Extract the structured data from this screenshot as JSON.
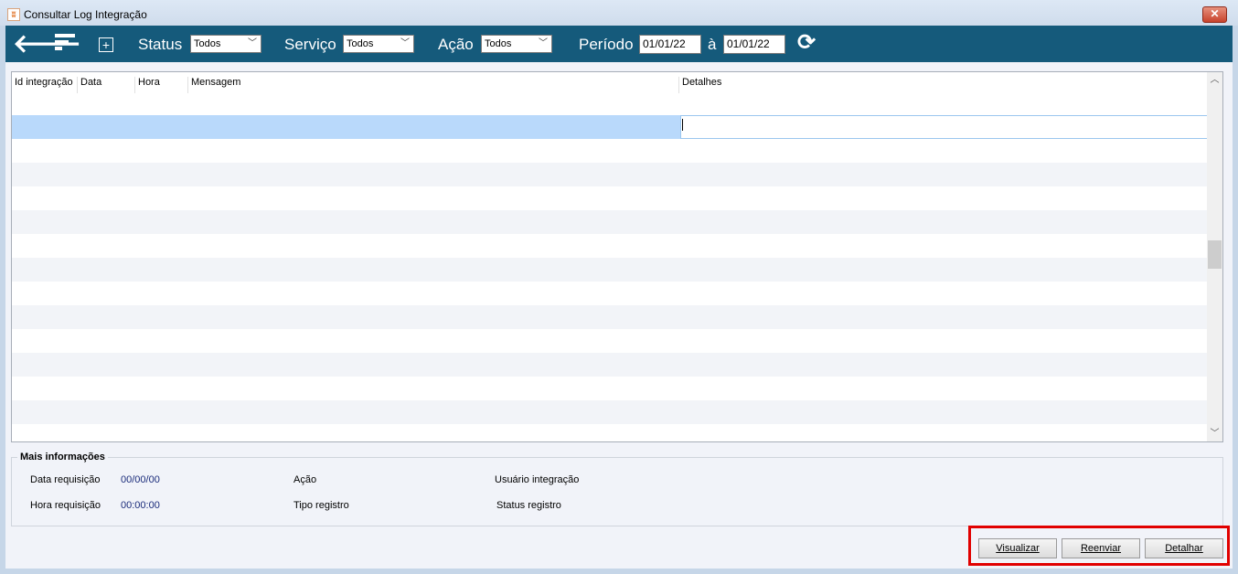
{
  "window": {
    "title": "Consultar Log Integração",
    "app_icon": "app-logo-icon",
    "close_symbol": "✕"
  },
  "toolbar": {
    "status_label": "Status",
    "status_value": "Todos",
    "servico_label": "Serviço",
    "servico_value": "Todos",
    "acao_label": "Ação",
    "acao_value": "Todos",
    "periodo_label": "Período",
    "date_from": "01/01/22",
    "date_separator": "à",
    "date_to": "01/01/22",
    "icons": [
      "back-arrow-icon",
      "filter-icon",
      "add-icon",
      "refresh-icon"
    ]
  },
  "grid": {
    "columns": [
      "Id integração",
      "Data",
      "Hora",
      "Mensagem",
      "Detalhes"
    ],
    "rows": []
  },
  "info": {
    "title": "Mais informações",
    "data_requisicao_label": "Data requisição",
    "data_requisicao_value": "00/00/00",
    "hora_requisicao_label": "Hora requisição",
    "hora_requisicao_value": "00:00:00",
    "acao_label": "Ação",
    "tipo_registro_label": "Tipo registro",
    "usuario_integracao_label": "Usuário integração",
    "status_registro_label": "Status registro"
  },
  "buttons": {
    "visualizar": "Visualizar",
    "reenviar": "Reenviar",
    "detalhar": "Detalhar"
  },
  "colors": {
    "toolbar": "#155a7b",
    "selection": "#b9d9fb",
    "highlight_border": "#e10000"
  }
}
